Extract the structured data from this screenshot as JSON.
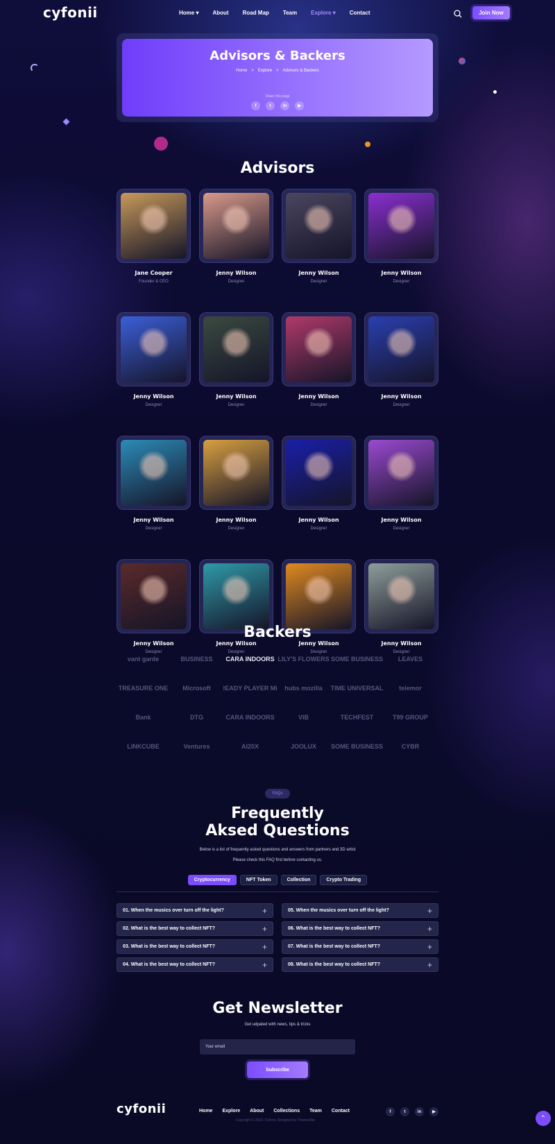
{
  "header": {
    "logo": "cyfonii",
    "nav": [
      "Home ▾",
      "About",
      "Road Map",
      "Team",
      "Explore ▾",
      "Contact"
    ],
    "active_nav": 4,
    "join": "Join Now",
    "search_icon": "search-icon"
  },
  "hero": {
    "title": "Advisors & Backers",
    "breadcrumb": [
      "Home",
      ">",
      "Explore",
      ">",
      "Advisors & Backers"
    ],
    "share": "Share this page",
    "socials": [
      "f",
      "t",
      "in",
      "▶"
    ]
  },
  "advisors": {
    "title": "Advisors",
    "members": [
      {
        "name": "Jane Cooper",
        "role": "Founder & CEO",
        "color": "#c79a5a"
      },
      {
        "name": "Jenny Wilson",
        "role": "Designer",
        "color": "#d99a8a"
      },
      {
        "name": "Jenny Wilson",
        "role": "Designer",
        "color": "#4a4660"
      },
      {
        "name": "Jenny Wilson",
        "role": "Designer",
        "color": "#8a2fd0"
      },
      {
        "name": "Jenny Wilson",
        "role": "Designer",
        "color": "#3b5fd8"
      },
      {
        "name": "Jenny Wilson",
        "role": "Designer",
        "color": "#3a4a40"
      },
      {
        "name": "Jenny Wilson",
        "role": "Designer",
        "color": "#b03a6a"
      },
      {
        "name": "Jenny Wilson",
        "role": "Designer",
        "color": "#2a3fb0"
      },
      {
        "name": "Jenny Wilson",
        "role": "Designer",
        "color": "#2c8bb8"
      },
      {
        "name": "Jenny Wilson",
        "role": "Designer",
        "color": "#d8a040"
      },
      {
        "name": "Jenny Wilson",
        "role": "Designer",
        "color": "#1a1fa8"
      },
      {
        "name": "Jenny Wilson",
        "role": "Designer",
        "color": "#9a4ad0"
      },
      {
        "name": "Jenny Wilson",
        "role": "Designer",
        "color": "#5a2a2a"
      },
      {
        "name": "Jenny Wilson",
        "role": "Designer",
        "color": "#2f9aa8"
      },
      {
        "name": "Jenny Wilson",
        "role": "Designer",
        "color": "#e08a20"
      },
      {
        "name": "Jenny Wilson",
        "role": "Designer",
        "color": "#8e9e9a"
      }
    ]
  },
  "backers": {
    "title": "Backers",
    "logos": [
      "vant garde",
      "BUSINESS",
      "CARA INDOORS",
      "LILY'S FLOWERS",
      "SOME BUSINESS",
      "LEAVES",
      "TREASURE ONE",
      "Microsoft",
      "READY PLAYER ME",
      "hubs mozilla",
      "TIME UNIVERSAL",
      "telemor",
      "Bank",
      "DTG",
      "CARA INDOORS",
      "VIB",
      "TECHFEST",
      "T99 GROUP",
      "LINKCUBE",
      "Ventures",
      "AI20X",
      "JOOLUX",
      "SOME BUSINESS",
      "CYBR"
    ]
  },
  "faq": {
    "badge": "FAQs",
    "title_line1": "Frequently",
    "title_line2": "Aksed Questions",
    "sub1": "Below is a list of frequently asked questions and answers from partners and 3D artist",
    "sub2": "Please check this FAQ first before contacting us.",
    "tabs": [
      "Cryptocurrency",
      "NFT Token",
      "Collection",
      "Crypto Trading"
    ],
    "left": [
      "01. When the musics over turn off the light?",
      "02. What is the best way to collect NFT?",
      "03. What is the best way to collect NFT?",
      "04. What is the best way to collect NFT?"
    ],
    "right": [
      "05. When the musics over turn off the light?",
      "06. What is the best way to collect NFT?",
      "07. What is the best way to collect NFT?",
      "08. What is the best way to collect NFT?"
    ]
  },
  "newsletter": {
    "title": "Get Newsletter",
    "sub": "Get udpated with news, tips & tricks",
    "placeholder": "Your email",
    "button": "Subscribe"
  },
  "footer": {
    "logo": "cyfonii",
    "nav": [
      "Home",
      "Explore",
      "About",
      "Collections",
      "Team",
      "Contact"
    ],
    "copyright": "Copyright © 2023. Cyfonii. Designed by Themesflat",
    "socials": [
      "f",
      "t",
      "in",
      "▶"
    ],
    "up": "⌃"
  }
}
